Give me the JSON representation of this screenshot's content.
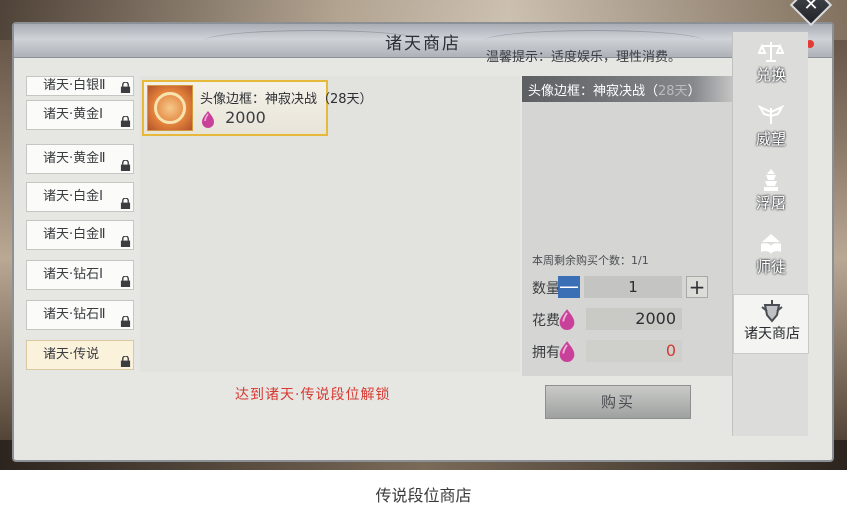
{
  "window": {
    "title": "诸天商店"
  },
  "tip": "温馨提示：适度娱乐，理性消费。",
  "tiers": [
    {
      "label": "诸天·白银Ⅱ"
    },
    {
      "label": "诸天·黄金Ⅰ"
    },
    {
      "label": "诸天·黄金Ⅱ"
    },
    {
      "label": "诸天·白金Ⅰ"
    },
    {
      "label": "诸天·白金Ⅱ"
    },
    {
      "label": "诸天·钻石Ⅰ"
    },
    {
      "label": "诸天·钻石Ⅱ"
    },
    {
      "label": "诸天·传说"
    }
  ],
  "item": {
    "name": "头像边框：神寂决战（28天）",
    "price": "2000"
  },
  "detail": {
    "name_main": "头像边框：神寂决战（",
    "name_faded": "28天",
    "name_close": "）",
    "weekly": "本周剩余购买个数：1/1",
    "qty_label": "数量",
    "qty_value": "1",
    "minus": "—",
    "plus": "+",
    "cost_label": "花费",
    "cost_value": "2000",
    "own_label": "拥有",
    "own_value": "0"
  },
  "unlock": "达到诸天·传说段位解锁",
  "buy": "购买",
  "nav": [
    {
      "label": "兑换",
      "icon": "scale-icon"
    },
    {
      "label": "威望",
      "icon": "wings-icon"
    },
    {
      "label": "浮屠",
      "icon": "pagoda-icon"
    },
    {
      "label": "师徒",
      "icon": "book-icon"
    },
    {
      "label": "诸天商店",
      "icon": "emblem-icon"
    }
  ],
  "caption": "传说段位商店",
  "colors": {
    "accent_red": "#d23a35",
    "gem": "#c9409a",
    "selected_border": "#e6b93a"
  }
}
